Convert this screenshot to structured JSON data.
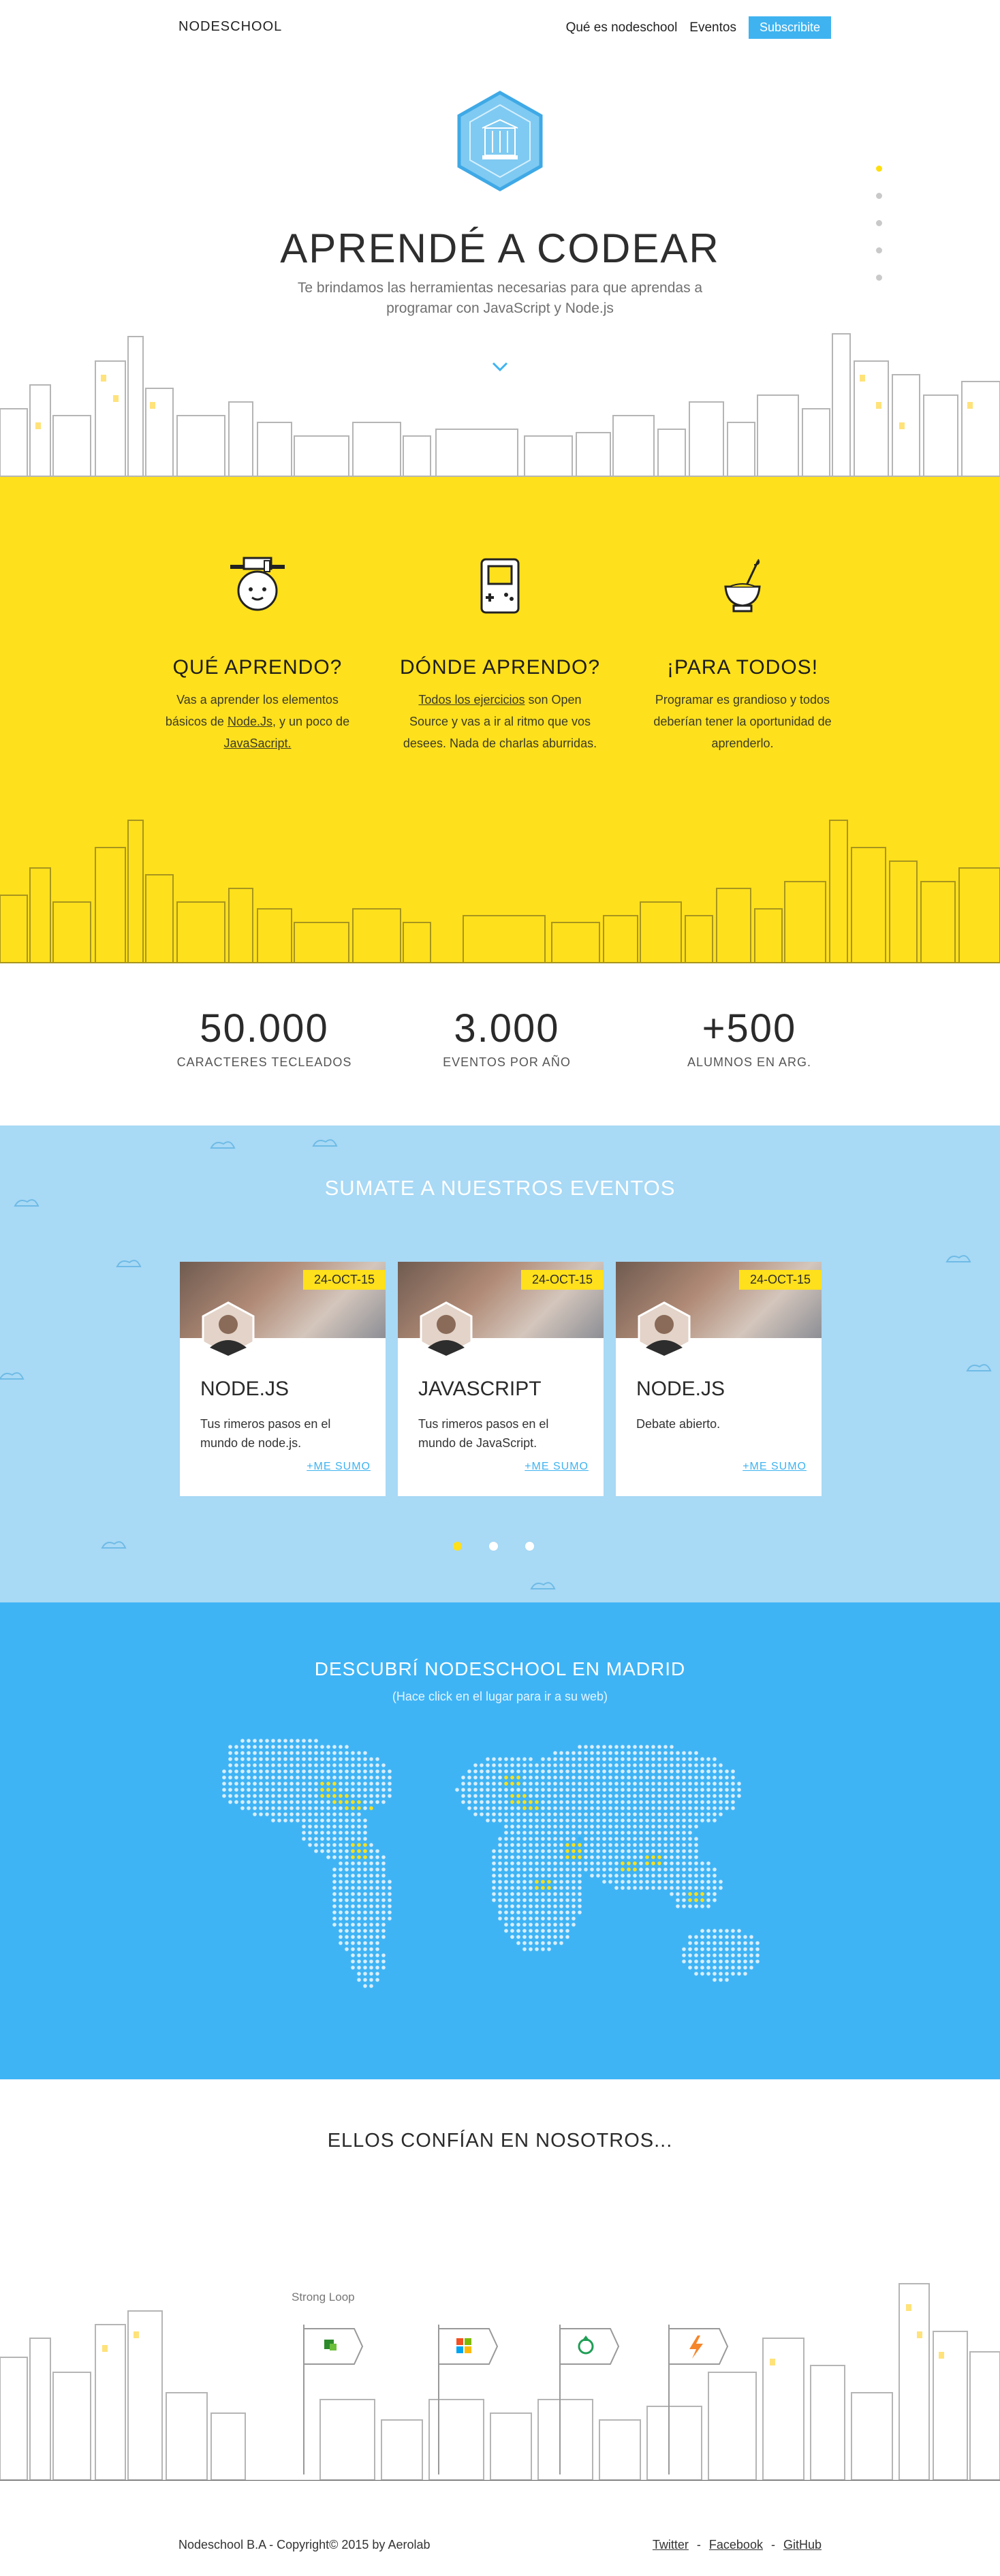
{
  "header": {
    "brand": "NODESCHOOL",
    "nav": [
      "Qué es nodeschool",
      "Eventos"
    ],
    "cta": "Subscribite"
  },
  "hero": {
    "title": "APRENDÉ A CODEAR",
    "subtitle": "Te brindamos las herramientas necesarias para que aprendas a programar con JavaScript y Node.js",
    "logo_icon": "nodeschool-hexagon-logo",
    "scroll_icon": "chevron-down-icon",
    "side_dots": 5,
    "side_dots_active": 0
  },
  "features": [
    {
      "icon": "graduate-face-icon",
      "title": "QUÉ APRENDO?",
      "text_before": "Vas a aprender los elementos básicos de ",
      "link1": "Node.Js",
      "text_mid": ", y un poco de ",
      "link2": "JavaSacript.",
      "text_after": ""
    },
    {
      "icon": "gameboy-icon",
      "title": "DÓNDE APRENDO?",
      "text_before": "",
      "link1": "Todos los ejercicios",
      "text_mid": " son Open Source y vas a ir al ritmo que vos desees. Nada de charlas aburridas.",
      "link2": "",
      "text_after": ""
    },
    {
      "icon": "mate-cup-icon",
      "title": "¡PARA TODOS!",
      "text_before": "Programar es grandioso y todos deberían tener la oportunidad de aprenderlo.",
      "link1": "",
      "text_mid": "",
      "link2": "",
      "text_after": ""
    }
  ],
  "stats": [
    {
      "value": "50.000",
      "label": "CARACTERES TECLEADOS"
    },
    {
      "value": "3.000",
      "label": "EVENTOS POR AÑO"
    },
    {
      "value": "+500",
      "label": "ALUMNOS EN ARG."
    }
  ],
  "events": {
    "title": "SUMATE A NUESTROS EVENTOS",
    "cards": [
      {
        "date": "24-OCT-15",
        "title": "NODE.JS",
        "desc": "Tus rimeros pasos en el mundo de node.js.",
        "join": "+ME SUMO"
      },
      {
        "date": "24-OCT-15",
        "title": "JAVASCRIPT",
        "desc": "Tus rimeros pasos en el mundo de JavaScript.",
        "join": "+ME SUMO"
      },
      {
        "date": "24-OCT-15",
        "title": "NODE.JS",
        "desc": "Debate abierto.",
        "join": "+ME SUMO"
      }
    ],
    "pager_count": 3,
    "pager_active": 0
  },
  "map": {
    "title": "DESCUBRÍ NODESCHOOL EN MADRID",
    "hint": "(Hace click en el lugar para ir a su web)",
    "dot_color": "#d8eefc",
    "highlight_color": "#ffe01c"
  },
  "trust": {
    "title": "ELLOS CONFÍAN EN NOSOTROS...",
    "sponsor_label": "Strong Loop",
    "sponsors": [
      "strongloop-logo-icon",
      "microsoft-logo-icon",
      "recycle-logo-icon",
      "lightning-logo-icon"
    ]
  },
  "footer": {
    "copyright": "Nodeschool B.A - Copyright© 2015 by Aerolab",
    "links": [
      "Twitter",
      "Facebook",
      "GitHub"
    ],
    "separator": "-"
  },
  "colors": {
    "yellow": "#ffe01c",
    "light_blue": "#a8d9f5",
    "blue": "#3fb4f5",
    "cta": "#3fb3f0"
  }
}
